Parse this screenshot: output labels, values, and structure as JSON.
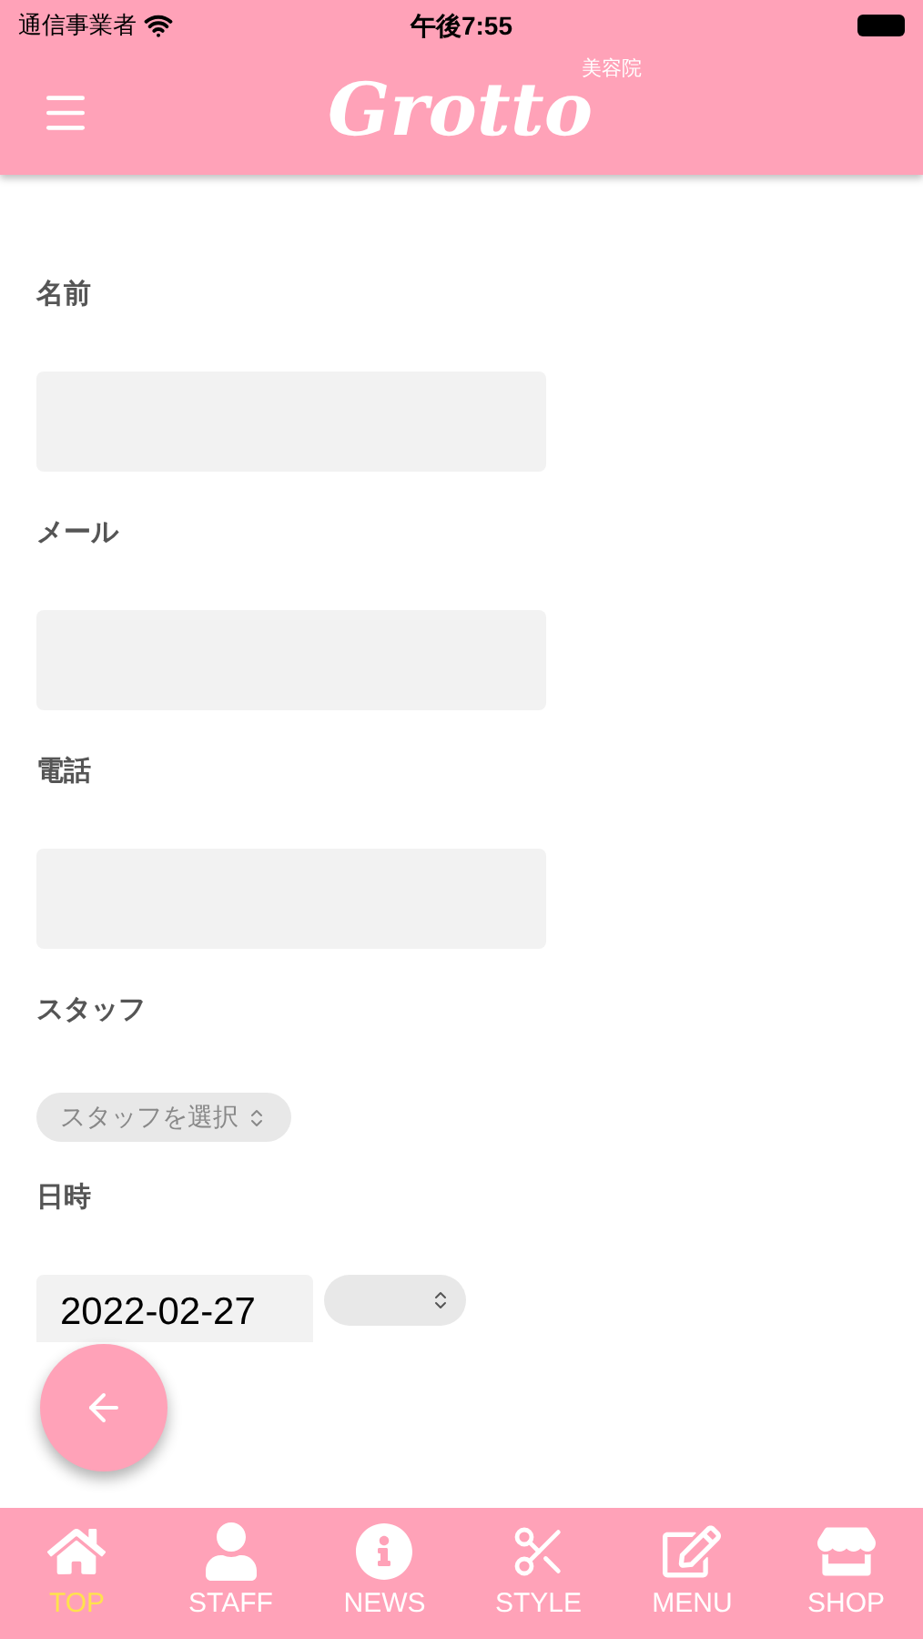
{
  "status_bar": {
    "carrier": "通信事業者",
    "time": "午後7:55"
  },
  "header": {
    "logo": "Grotto",
    "logo_sub": "美容院"
  },
  "form": [
    {
      "kind": "text",
      "label": "名前"
    },
    {
      "kind": "text",
      "label": "メール"
    },
    {
      "kind": "text",
      "label": "電話"
    },
    {
      "kind": "select",
      "label": "スタッフ",
      "value": "スタッフを選択"
    },
    {
      "kind": "datetime",
      "label": "日時",
      "date": "2022-02-27"
    }
  ],
  "tab_bar": [
    {
      "kind": "home",
      "label": "TOP",
      "selected": true
    },
    {
      "kind": "user",
      "label": "STAFF",
      "selected": false
    },
    {
      "kind": "info",
      "label": "NEWS",
      "selected": false
    },
    {
      "kind": "scissors",
      "label": "STYLE",
      "selected": false
    },
    {
      "kind": "edit",
      "label": "MENU",
      "selected": false
    },
    {
      "kind": "store",
      "label": "SHOP",
      "selected": false
    }
  ]
}
